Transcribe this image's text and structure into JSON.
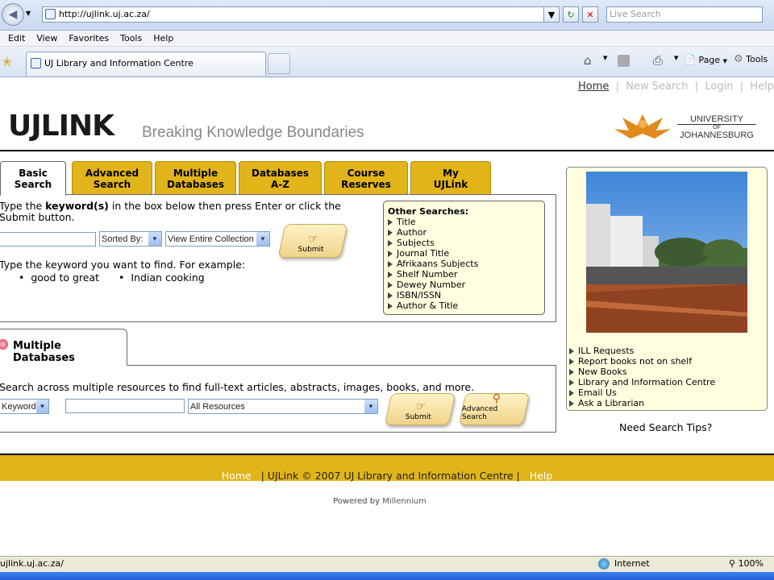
{
  "browser": {
    "url": "http://ujlink.uj.ac.za/",
    "search_placeholder": "Live Search",
    "menu": [
      "Edit",
      "View",
      "Favorites",
      "Tools",
      "Help"
    ],
    "tab_title": "UJ Library and Information Centre",
    "tools": {
      "page": "Page",
      "tools": "Tools"
    },
    "status_url": "ujlink.uj.ac.za/",
    "zone": "Internet",
    "zoom": "100%"
  },
  "toplinks": {
    "home": "Home",
    "new_search": "New Search",
    "login": "Login",
    "help": "Help"
  },
  "header": {
    "logo": "UJLINK",
    "tagline": "Breaking Knowledge Boundaries",
    "uni_line1": "UNIVERSITY",
    "uni_line2": "OF",
    "uni_line3": "JOHANNESBURG"
  },
  "tabs": [
    {
      "l1": "Basic",
      "l2": "Search"
    },
    {
      "l1": "Advanced",
      "l2": "Search"
    },
    {
      "l1": "Multiple",
      "l2": "Databases"
    },
    {
      "l1": "Databases",
      "l2": "A-Z"
    },
    {
      "l1": "Course",
      "l2": "Reserves"
    },
    {
      "l1": "My",
      "l2": "UJLink"
    }
  ],
  "basic": {
    "instr_pre": "Type the ",
    "instr_bold": "keyword(s)",
    "instr_post": " in the box below then press Enter or click the",
    "instr_line2": "Submit button.",
    "sorted_by": "Sorted By:",
    "collection": "View Entire Collection",
    "submit": "Submit",
    "example_text": "Type the keyword you want to find. For example:",
    "examples": [
      "good to great",
      "Indian cooking"
    ]
  },
  "other_searches": {
    "title": "Other Searches:",
    "items": [
      "Title",
      "Author",
      "Subjects",
      "Journal Title",
      "Afrikaans Subjects",
      "Shelf Number",
      "Dewey Number",
      "ISBN/ISSN",
      "Author & Title"
    ]
  },
  "multi": {
    "tab": "Multiple Databases",
    "desc": "Search across multiple resources to find full-text articles, abstracts, images, books, and more.",
    "keyword": "Keyword",
    "resources": "All Resources",
    "submit": "Submit",
    "advanced": "Advanced Search"
  },
  "sidebar": {
    "links": [
      "ILL Requests",
      "Report books not on shelf",
      "New Books",
      "Library and Information Centre",
      "Email Us",
      "Ask a Librarian"
    ],
    "tips": "Need Search Tips?"
  },
  "footer": {
    "home": "Home",
    "copy": "| UJLink © 2007 UJ Library and Information Centre |",
    "help": "Help",
    "powered_pre": "Powered by ",
    "powered_name": "Millennium"
  }
}
